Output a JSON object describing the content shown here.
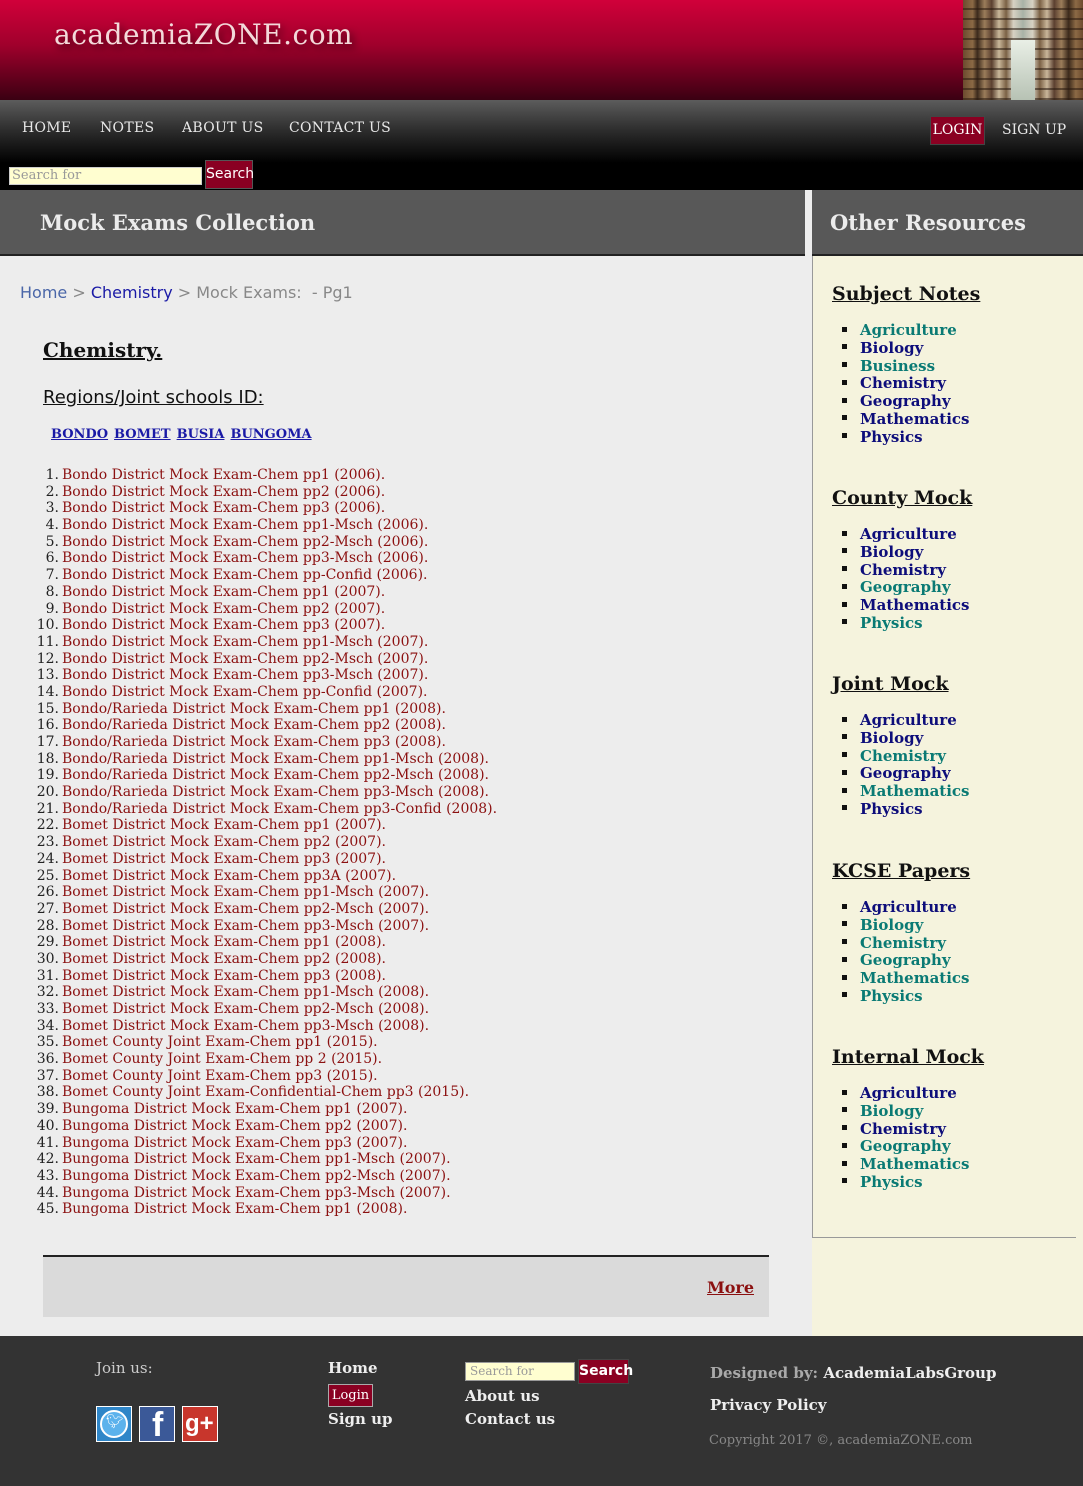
{
  "site": {
    "title": "academiaZONE.com"
  },
  "nav": {
    "items": [
      "HOME",
      "NOTES",
      "ABOUT US",
      "CONTACT US"
    ],
    "login_label": "LOGIN",
    "signup_label": "SIGN UP",
    "search_placeholder": "Search for",
    "search_button": "Search"
  },
  "main": {
    "header": "Mock Exams Collection",
    "breadcrumb": {
      "home": "Home",
      "sep1": " > ",
      "subject": "Chemistry",
      "sep2": " > ",
      "current": "Mock Exams:  - Pg1"
    },
    "subject_title": "Chemistry.",
    "regions_title": "Regions/Joint schools ID:",
    "regions": [
      "BONDO",
      "BOMET",
      "BUSIA",
      "BUNGOMA"
    ],
    "exams": [
      "Bondo District Mock Exam-Chem pp1 (2006).",
      "Bondo District Mock Exam-Chem pp2 (2006).",
      "Bondo District Mock Exam-Chem pp3 (2006).",
      "Bondo District Mock Exam-Chem pp1-Msch (2006).",
      "Bondo District Mock Exam-Chem pp2-Msch (2006).",
      "Bondo District Mock Exam-Chem pp3-Msch (2006).",
      "Bondo District Mock Exam-Chem pp-Confid (2006).",
      "Bondo District Mock Exam-Chem pp1 (2007).",
      "Bondo District Mock Exam-Chem pp2 (2007).",
      "Bondo District Mock Exam-Chem pp3 (2007).",
      "Bondo District Mock Exam-Chem pp1-Msch (2007).",
      "Bondo District Mock Exam-Chem pp2-Msch (2007).",
      "Bondo District Mock Exam-Chem pp3-Msch (2007).",
      "Bondo District Mock Exam-Chem pp-Confid (2007).",
      "Bondo/Rarieda District Mock Exam-Chem pp1 (2008).",
      "Bondo/Rarieda District Mock Exam-Chem pp2 (2008).",
      "Bondo/Rarieda District Mock Exam-Chem pp3 (2008).",
      "Bondo/Rarieda District Mock Exam-Chem pp1-Msch (2008).",
      "Bondo/Rarieda District Mock Exam-Chem pp2-Msch (2008).",
      "Bondo/Rarieda District Mock Exam-Chem pp3-Msch (2008).",
      "Bondo/Rarieda District Mock Exam-Chem pp3-Confid (2008).",
      "Bomet District Mock Exam-Chem pp1 (2007).",
      "Bomet District Mock Exam-Chem pp2 (2007).",
      "Bomet District Mock Exam-Chem pp3 (2007).",
      "Bomet District Mock Exam-Chem pp3A (2007).",
      "Bomet District Mock Exam-Chem pp1-Msch (2007).",
      "Bomet District Mock Exam-Chem pp2-Msch (2007).",
      "Bomet District Mock Exam-Chem pp3-Msch (2007).",
      "Bomet District Mock Exam-Chem pp1 (2008).",
      "Bomet District Mock Exam-Chem pp2 (2008).",
      "Bomet District Mock Exam-Chem pp3 (2008).",
      "Bomet District Mock Exam-Chem pp1-Msch (2008).",
      "Bomet District Mock Exam-Chem pp2-Msch (2008).",
      "Bomet District Mock Exam-Chem pp3-Msch (2008).",
      "Bomet County Joint Exam-Chem pp1 (2015).",
      "Bomet County Joint Exam-Chem pp 2 (2015).",
      "Bomet County Joint Exam-Chem pp3 (2015).",
      "Bomet County Joint Exam-Confidential-Chem pp3 (2015).",
      "Bungoma District Mock Exam-Chem pp1 (2007).",
      "Bungoma District Mock Exam-Chem pp2 (2007).",
      "Bungoma District Mock Exam-Chem pp3 (2007).",
      "Bungoma District Mock Exam-Chem pp1-Msch (2007).",
      "Bungoma District Mock Exam-Chem pp2-Msch (2007).",
      "Bungoma District Mock Exam-Chem pp3-Msch (2007).",
      "Bungoma District Mock Exam-Chem pp1 (2008)."
    ],
    "more_label": "More"
  },
  "sidebar": {
    "header": "Other Resources",
    "sections": [
      {
        "title": "Subject Notes",
        "items": [
          {
            "label": "Agriculture",
            "color": "#0a7a74"
          },
          {
            "label": "Biology",
            "color": "#0d0d7a"
          },
          {
            "label": "Business",
            "color": "#0a7a74"
          },
          {
            "label": "Chemistry",
            "color": "#0d0d7a"
          },
          {
            "label": "Geography",
            "color": "#0d0d7a"
          },
          {
            "label": "Mathematics",
            "color": "#0d0d7a"
          },
          {
            "label": "Physics",
            "color": "#0d0d7a"
          }
        ]
      },
      {
        "title": "County Mock",
        "items": [
          {
            "label": "Agriculture",
            "color": "#0d0d7a"
          },
          {
            "label": "Biology",
            "color": "#0d0d7a"
          },
          {
            "label": "Chemistry",
            "color": "#0d0d7a"
          },
          {
            "label": "Geography",
            "color": "#0a7a74"
          },
          {
            "label": "Mathematics",
            "color": "#0d0d7a"
          },
          {
            "label": "Physics",
            "color": "#0a7a74"
          }
        ]
      },
      {
        "title": "Joint Mock",
        "items": [
          {
            "label": "Agriculture",
            "color": "#0d0d7a"
          },
          {
            "label": "Biology",
            "color": "#0d0d7a"
          },
          {
            "label": "Chemistry",
            "color": "#0a7a74"
          },
          {
            "label": "Geography",
            "color": "#0d0d7a"
          },
          {
            "label": "Mathematics",
            "color": "#0a7a74"
          },
          {
            "label": "Physics",
            "color": "#0d0d7a"
          }
        ]
      },
      {
        "title": "KCSE Papers",
        "items": [
          {
            "label": "Agriculture",
            "color": "#0d0d7a"
          },
          {
            "label": "Biology",
            "color": "#0a7a74"
          },
          {
            "label": "Chemistry",
            "color": "#0a7a74"
          },
          {
            "label": "Geography",
            "color": "#0a7a74"
          },
          {
            "label": "Mathematics",
            "color": "#0a7a74"
          },
          {
            "label": "Physics",
            "color": "#0a7a74"
          }
        ]
      },
      {
        "title": "Internal Mock",
        "items": [
          {
            "label": "Agriculture",
            "color": "#0d0d7a"
          },
          {
            "label": "Biology",
            "color": "#0a7a74"
          },
          {
            "label": "Chemistry",
            "color": "#0d0d7a"
          },
          {
            "label": "Geography",
            "color": "#0a7a74"
          },
          {
            "label": "Mathematics",
            "color": "#0a7a74"
          },
          {
            "label": "Physics",
            "color": "#0a7a74"
          }
        ]
      }
    ]
  },
  "footer": {
    "join_us": "Join us:",
    "social_icons": [
      "twitter-icon",
      "facebook-icon",
      "google-plus-icon"
    ],
    "home": "Home",
    "login": "Login",
    "signup": "Sign up",
    "search_placeholder": "Search for",
    "search_button": "Search",
    "about": "About us",
    "contact": "Contact us",
    "designed_by_label": "Designed by:",
    "designed_by_name": "AcademiaLabsGroup",
    "privacy": "Privacy Policy",
    "copyright": "Copyright 2017 ©, academiaZONE.com"
  },
  "colors": {
    "brand": "#8a0022",
    "link_red": "#8b1010",
    "link_blue": "#0d0d7a",
    "link_teal": "#0a7a74"
  }
}
